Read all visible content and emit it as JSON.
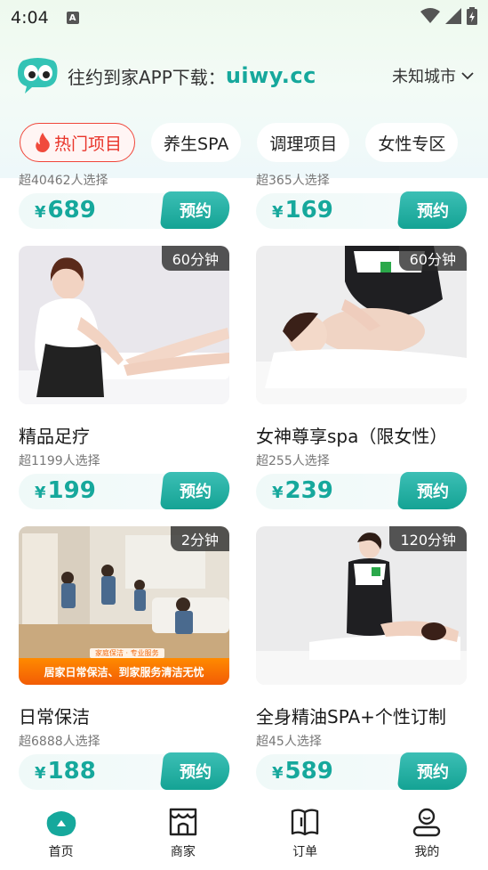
{
  "status": {
    "time": "4:04",
    "notif_letter": "A"
  },
  "header": {
    "brand_text": "往约到家APP下载：",
    "brand_url": "uiwy.cc",
    "city": "未知城市"
  },
  "tabs": [
    {
      "label": "热门项目",
      "active": true
    },
    {
      "label": "养生SPA",
      "active": false
    },
    {
      "label": "调理项目",
      "active": false
    },
    {
      "label": "女性专区",
      "active": false
    }
  ],
  "cards_partial": [
    {
      "sub": "超40462人选择",
      "price": "689",
      "book": "预约"
    },
    {
      "sub": "超365人选择",
      "price": "169",
      "book": "预约"
    }
  ],
  "cards": [
    {
      "title": "精品足疗",
      "sub": "超1199人选择",
      "price": "199",
      "duration": "60分钟",
      "book": "预约"
    },
    {
      "title": "女神尊享spa（限女性）",
      "sub": "超255人选择",
      "price": "239",
      "duration": "60分钟",
      "book": "预约"
    },
    {
      "title": "日常保洁",
      "sub": "超6888人选择",
      "price": "188",
      "duration": "2分钟",
      "book": "预约",
      "banner_small": "家庭保洁 · 专业服务",
      "banner": "居家日常保洁、到家服务清洁无忧"
    },
    {
      "title": "全身精油SPA+个性订制",
      "sub": "超45人选择",
      "price": "589",
      "duration": "120分钟",
      "book": "预约"
    }
  ],
  "currency": "¥",
  "nav": [
    {
      "label": "首页",
      "icon": "home-icon",
      "active": true
    },
    {
      "label": "商家",
      "icon": "store-icon",
      "active": false
    },
    {
      "label": "订单",
      "icon": "order-book-icon",
      "active": false
    },
    {
      "label": "我的",
      "icon": "profile-icon",
      "active": false
    }
  ],
  "colors": {
    "accent": "#16a89c",
    "tab_active": "#e9342a"
  }
}
